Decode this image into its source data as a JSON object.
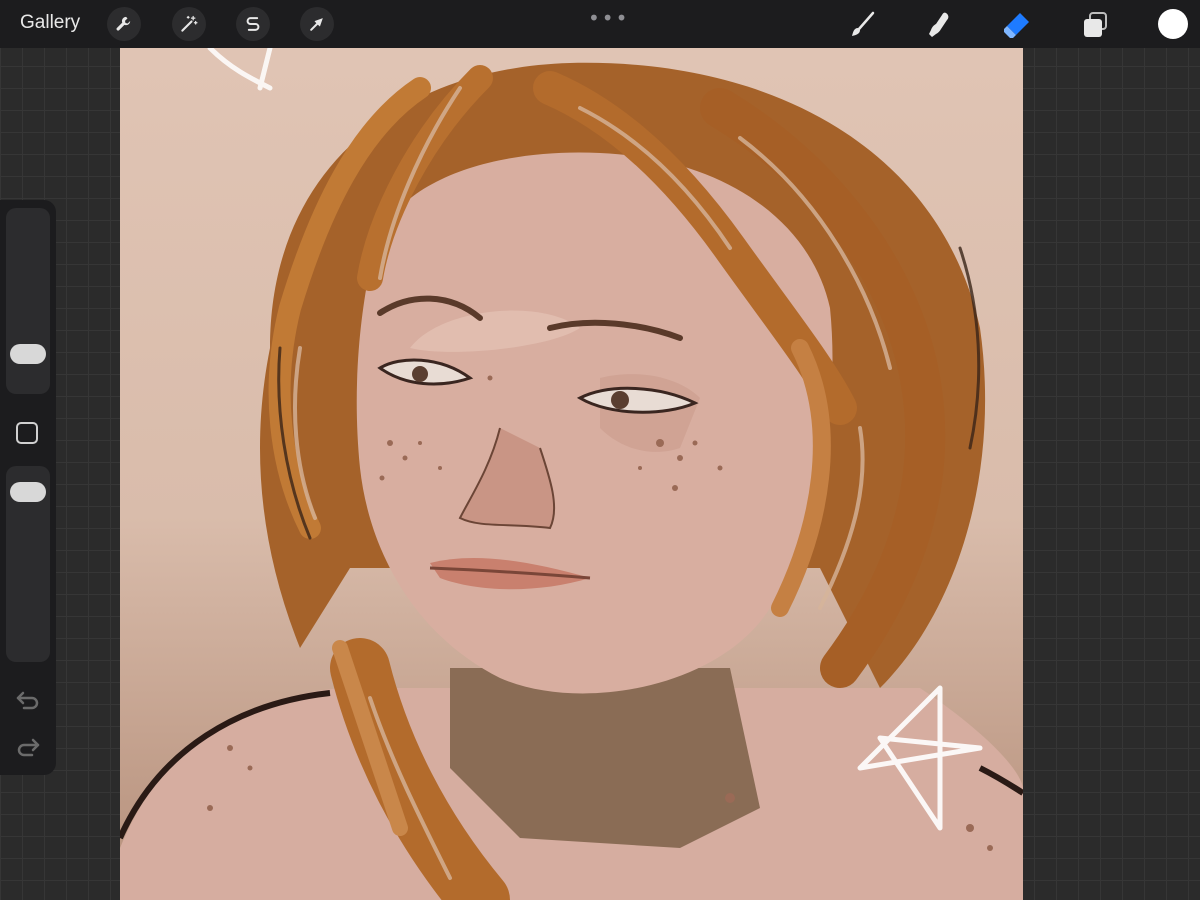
{
  "topbar": {
    "gallery_label": "Gallery",
    "actions": [
      {
        "name": "actions",
        "icon": "wrench-icon"
      },
      {
        "name": "adjustments",
        "icon": "magic-wand-icon"
      },
      {
        "name": "selection",
        "icon": "selection-s-icon"
      },
      {
        "name": "transform",
        "icon": "arrow-cursor-icon"
      }
    ],
    "more_label": "•••",
    "tools": [
      {
        "name": "brush",
        "icon": "brush-icon",
        "active": false
      },
      {
        "name": "smudge",
        "icon": "smudge-finger-icon",
        "active": false
      },
      {
        "name": "eraser",
        "icon": "eraser-icon",
        "active": true
      },
      {
        "name": "layers",
        "icon": "layers-icon",
        "active": false
      }
    ],
    "current_color": "#ffffff"
  },
  "sidebar": {
    "brush_size_level": 0.45,
    "opacity_level": 0.85,
    "undo_icon": "undo-icon",
    "redo_icon": "redo-icon"
  },
  "colors": {
    "accent": "#1e7bff",
    "hair": "#b06a2a",
    "skin": "#d9b0a0",
    "background_top": "#e0c4b4",
    "background_bottom": "#b58f7a"
  }
}
